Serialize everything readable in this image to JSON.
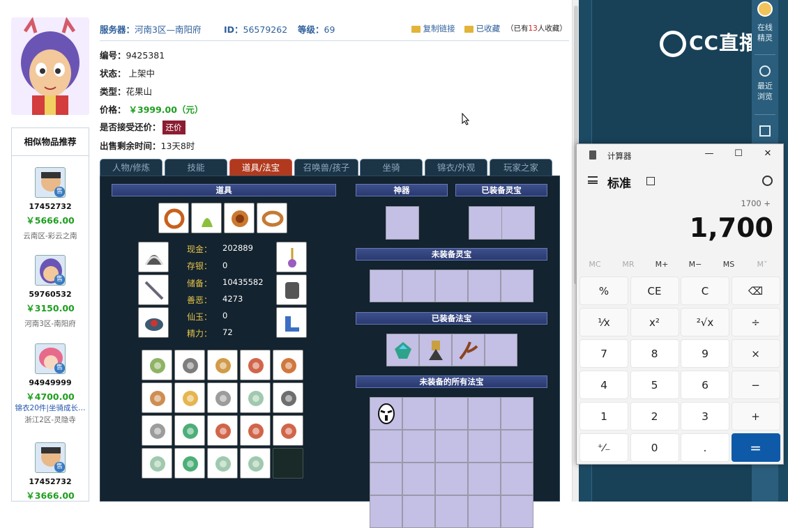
{
  "header": {
    "server_label": "服务器：",
    "server_value": "河南3区—南阳府",
    "id_label": "ID：",
    "id_value": "56579262",
    "level_label": "等级：",
    "level_value": "69",
    "copy_link": "复制链接",
    "favorited": "已收藏",
    "fav_prefix": "（已有",
    "fav_count": "13",
    "fav_suffix": "人收藏）"
  },
  "info": {
    "serial_label": "编号：",
    "serial_value": "9425381",
    "status_label": "状态：",
    "status_value": "上架中",
    "type_label": "类型：",
    "type_value": "花果山",
    "price_label": "价格：",
    "price_value": "￥3999.00（元）",
    "haggle_label": "是否接受还价：",
    "haggle_button": "还价",
    "remain_label": "出售剩余时间：",
    "remain_value": "13天8时"
  },
  "similar": {
    "title": "相似物品推荐",
    "sale_badge": "售",
    "items": [
      {
        "id": "17452732",
        "price": "￥5666.00",
        "server": "云南区-彩云之南"
      },
      {
        "id": "59760532",
        "price": "￥3150.00",
        "server": "河南3区-南阳府"
      },
      {
        "id": "94949999",
        "price": "￥4700.00",
        "tag": "锦衣20件|坐骑成长…",
        "server": "浙江2区-灵隐寺"
      },
      {
        "id": "17452732",
        "price": "￥3666.00"
      }
    ]
  },
  "tabs": [
    "人物/修炼",
    "技能",
    "道具/法宝",
    "召唤兽/孩子",
    "坐骑",
    "锦衣/外观",
    "玩家之家"
  ],
  "game": {
    "items_header": "道具",
    "shenqi_header": "神器",
    "equipped_lingbao": "已装备灵宝",
    "unequipped_lingbao": "未装备灵宝",
    "equipped_fabao": "已装备法宝",
    "unequipped_fabao": "未装备的所有法宝",
    "stats": [
      {
        "label": "现金：",
        "value": "202889"
      },
      {
        "label": "存银：",
        "value": "0"
      },
      {
        "label": "储备：",
        "value": "10435582"
      },
      {
        "label": "善恶：",
        "value": "4273"
      },
      {
        "label": "仙玉：",
        "value": "0"
      },
      {
        "label": "精力：",
        "value": "72"
      }
    ]
  },
  "rightpanel": {
    "online_label": "在线",
    "online_sub": "精灵",
    "recent_label": "最近",
    "recent_sub": "浏览",
    "logo_text": "CC直播"
  },
  "calculator": {
    "app_title": "计算器",
    "mode": "标准",
    "expression": "1700 +",
    "display": "1,700",
    "memory": [
      "MC",
      "MR",
      "M+",
      "M−",
      "MS",
      "M˅"
    ],
    "keys": [
      [
        "%",
        "CE",
        "C",
        "⌫"
      ],
      [
        "¹⁄x",
        "x²",
        "²√x",
        "÷"
      ],
      [
        "7",
        "8",
        "9",
        "×"
      ],
      [
        "4",
        "5",
        "6",
        "−"
      ],
      [
        "1",
        "2",
        "3",
        "+"
      ],
      [
        "⁺⁄₋",
        "0",
        ".",
        "="
      ]
    ]
  }
}
